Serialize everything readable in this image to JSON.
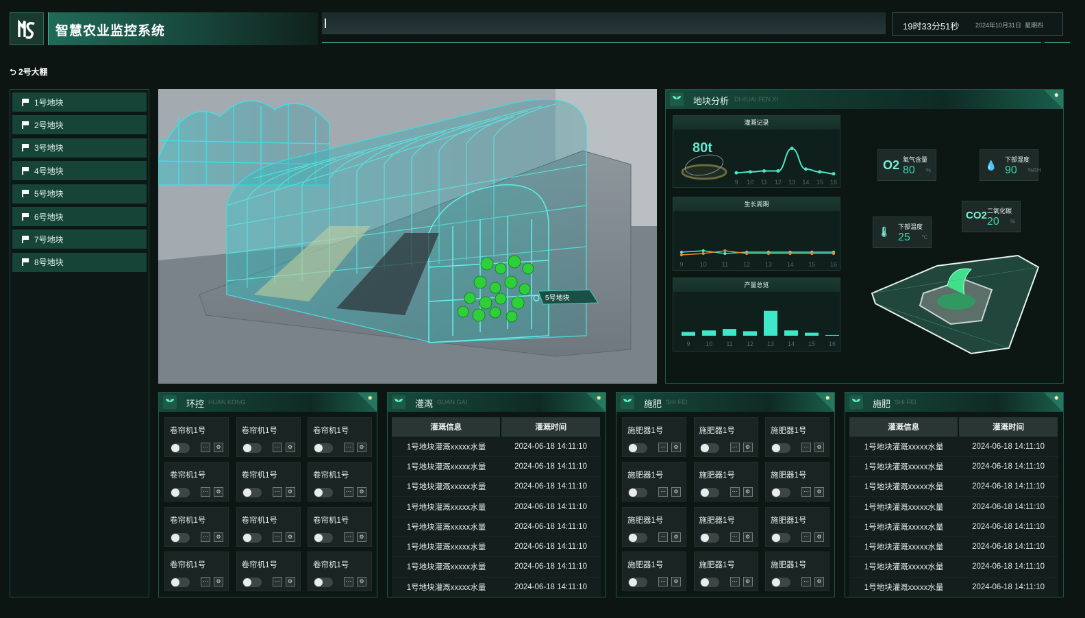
{
  "header": {
    "title": "智慧农业监控系统",
    "time": "19时33分51秒",
    "date": "2024年10月31日",
    "weekday": "星期四"
  },
  "breadcrumb": "2号大棚",
  "sidebar": {
    "items": [
      {
        "label": "1号地块"
      },
      {
        "label": "2号地块"
      },
      {
        "label": "3号地块"
      },
      {
        "label": "4号地块"
      },
      {
        "label": "5号地块"
      },
      {
        "label": "6号地块"
      },
      {
        "label": "7号地块"
      },
      {
        "label": "8号地块"
      }
    ]
  },
  "view3d": {
    "plot_label": "5号地块"
  },
  "analysis": {
    "title": "地块分析",
    "title_en": "DI KUAI FEN XI",
    "irrigation_record": {
      "title": "灌溉记录",
      "total": "80t"
    },
    "growth_cycle": {
      "title": "生长周期"
    },
    "yield_overview": {
      "title": "产量总览"
    },
    "metrics": [
      {
        "symbol": "O2",
        "label": "氧气含量",
        "value": "80",
        "unit": "%"
      },
      {
        "symbol": "💧",
        "label": "下部湿度",
        "value": "90",
        "unit": "%RH"
      },
      {
        "symbol": "CO2",
        "label": "二氧化碳",
        "value": "20",
        "unit": "%"
      },
      {
        "symbol": "🌡",
        "label": "下部温度",
        "value": "25",
        "unit": "℃"
      }
    ]
  },
  "chart_data": [
    {
      "type": "line",
      "title": "灌溉记录",
      "x": [
        "9",
        "10",
        "11",
        "12",
        "13",
        "14",
        "15",
        "16"
      ],
      "series": [
        {
          "values": [
            2,
            3,
            4,
            4,
            28,
            6,
            3,
            1
          ]
        }
      ],
      "ylim": [
        0,
        35
      ]
    },
    {
      "type": "line",
      "title": "生长周期",
      "x": [
        "9",
        "10",
        "11",
        "12",
        "13",
        "14",
        "15",
        "16"
      ],
      "series": [
        {
          "values": [
            5,
            6,
            4,
            5,
            5,
            5,
            5,
            5
          ]
        },
        {
          "values": [
            3,
            4,
            6,
            4,
            4,
            4,
            4,
            4
          ]
        }
      ],
      "ylim": [
        0,
        20
      ]
    },
    {
      "type": "bar",
      "title": "产量总览",
      "categories": [
        "9",
        "10",
        "11",
        "12",
        "13",
        "14",
        "15",
        "16"
      ],
      "values": [
        5,
        7,
        9,
        6,
        33,
        7,
        4,
        1
      ],
      "ylim": [
        0,
        40
      ]
    }
  ],
  "env_panel": {
    "title": "环控",
    "title_en": "HUAN KONG",
    "device": "卷帘机1号",
    "count": 12
  },
  "irrigation_panel": {
    "title": "灌溉",
    "title_en": "GUAN GAI",
    "columns": [
      "灌溉信息",
      "灌溉时间"
    ],
    "rows": [
      [
        "1号地块灌溉xxxxx水量",
        "2024-06-18 14:11:10"
      ],
      [
        "1号地块灌溉xxxxx水量",
        "2024-06-18 14:11:10"
      ],
      [
        "1号地块灌溉xxxxx水量",
        "2024-06-18 14:11:10"
      ],
      [
        "1号地块灌溉xxxxx水量",
        "2024-06-18 14:11:10"
      ],
      [
        "1号地块灌溉xxxxx水量",
        "2024-06-18 14:11:10"
      ],
      [
        "1号地块灌溉xxxxx水量",
        "2024-06-18 14:11:10"
      ],
      [
        "1号地块灌溉xxxxx水量",
        "2024-06-18 14:11:10"
      ],
      [
        "1号地块灌溉xxxxx水量",
        "2024-06-18 14:11:10"
      ]
    ]
  },
  "fert_panel": {
    "title": "施肥",
    "title_en": "SHI FEI",
    "device": "施肥器1号",
    "count": 12
  },
  "fert_log_panel": {
    "title": "施肥",
    "title_en": "SHI FEI",
    "columns": [
      "灌溉信息",
      "灌溉时间"
    ],
    "rows": [
      [
        "1号地块灌溉xxxxx水量",
        "2024-06-18 14:11:10"
      ],
      [
        "1号地块灌溉xxxxx水量",
        "2024-06-18 14:11:10"
      ],
      [
        "1号地块灌溉xxxxx水量",
        "2024-06-18 14:11:10"
      ],
      [
        "1号地块灌溉xxxxx水量",
        "2024-06-18 14:11:10"
      ],
      [
        "1号地块灌溉xxxxx水量",
        "2024-06-18 14:11:10"
      ],
      [
        "1号地块灌溉xxxxx水量",
        "2024-06-18 14:11:10"
      ],
      [
        "1号地块灌溉xxxxx水量",
        "2024-06-18 14:11:10"
      ],
      [
        "1号地块灌溉xxxxx水量",
        "2024-06-18 14:11:10"
      ]
    ]
  },
  "colors": {
    "accent": "#39d7b0",
    "panel_border": "#1f5a48",
    "sidebar_item": "#164436"
  }
}
